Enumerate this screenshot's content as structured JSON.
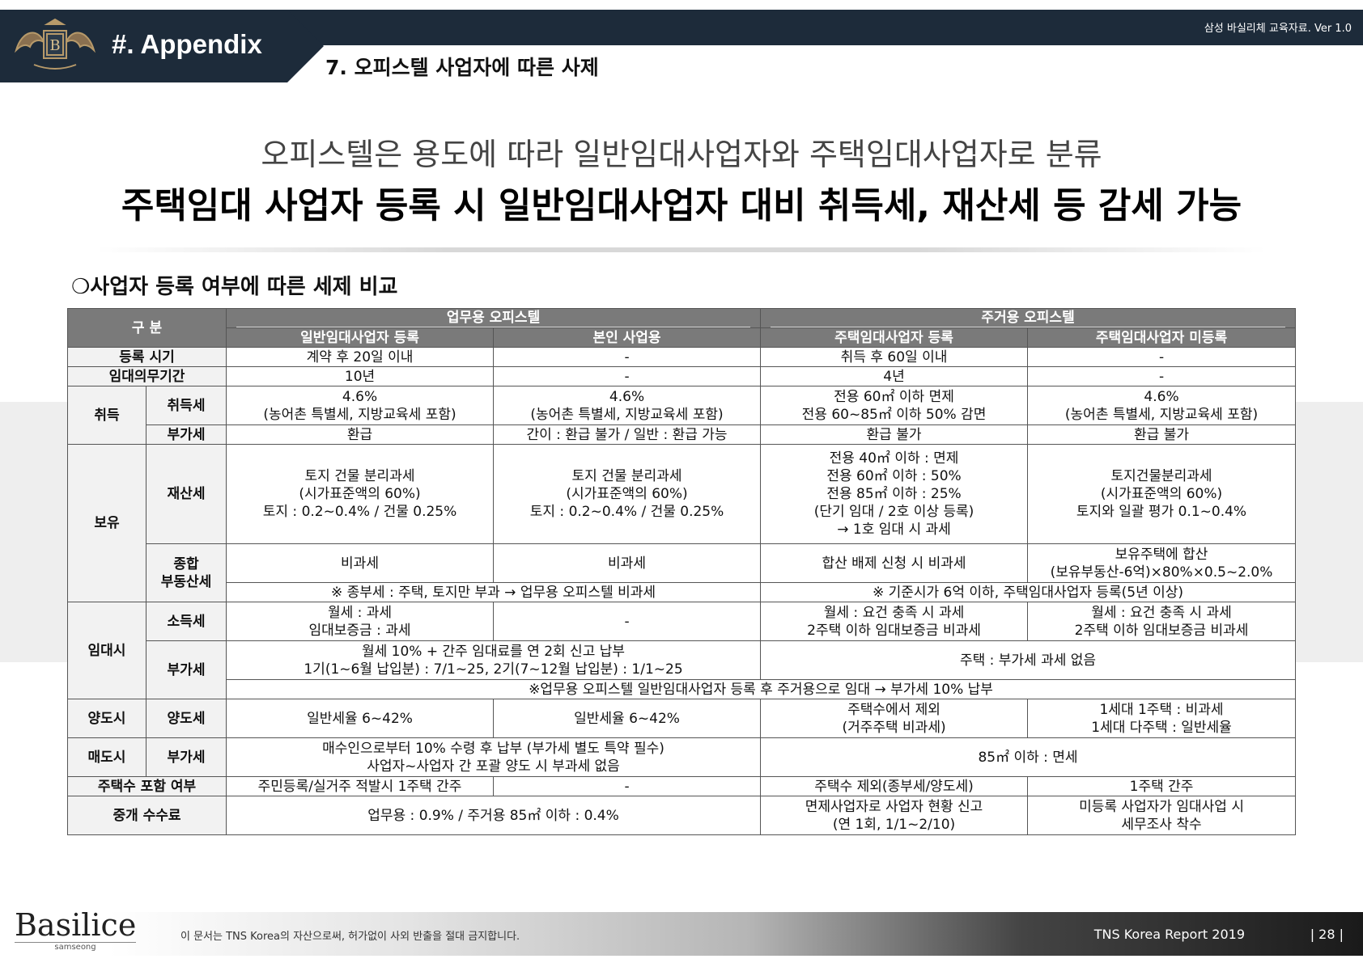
{
  "header": {
    "section": "#. Appendix",
    "title": "7. 오피스텔 사업자에 따른 사제",
    "doc_version": "삼성 바실리체 교육자료. Ver 1.0",
    "logo_icon": "crest-emblem-icon"
  },
  "headline": {
    "line1": "오피스텔은 용도에 따라 일반임대사업자와 주택임대사업자로 분류",
    "line2": "주택임대 사업자 등록 시 일반임대사업자 대비 취득세, 재산세 등 감세 가능"
  },
  "section_title": "❍사업자 등록 여부에 따른 세제 비교",
  "table": {
    "head": {
      "category": "구 분",
      "group_business": "업무용 오피스텔",
      "group_residential": "주거용 오피스텔",
      "col1": "일반임대사업자 등록",
      "col2": "본인 사업용",
      "col3": "주택임대사업자 등록",
      "col4": "주택임대사업자 미등록"
    },
    "reg_time": {
      "label": "등록 시기",
      "c1": "계약 후 20일 이내",
      "c2": "-",
      "c3": "취득 후 60일 이내",
      "c4": "-"
    },
    "lease_period": {
      "label": "임대의무기간",
      "c1": "10년",
      "c2": "-",
      "c3": "4년",
      "c4": "-"
    },
    "acquisition": {
      "group": "취득",
      "acq_tax": {
        "label": "취득세",
        "c1_l1": "4.6%",
        "c1_l2": "(농어촌 특별세, 지방교육세 포함)",
        "c2_l1": "4.6%",
        "c2_l2": "(농어촌 특별세, 지방교육세 포함)",
        "c3_l1": "전용 60㎡ 이하 면제",
        "c3_l2": "전용 60~85㎡ 이하 50% 감면",
        "c4_l1": "4.6%",
        "c4_l2": "(농어촌 특별세, 지방교육세 포함)"
      },
      "vat": {
        "label": "부가세",
        "c1": "환급",
        "c2": "간이 : 환급 불가 / 일반 : 환급 가능",
        "c3": "환급 불가",
        "c4": "환급 불가"
      }
    },
    "holding": {
      "group": "보유",
      "property_tax": {
        "label": "재산세",
        "c1_l1": "토지 건물 분리과세",
        "c1_l2": "(시가표준액의 60%)",
        "c1_l3": "토지 : 0.2~0.4% / 건물 0.25%",
        "c2_l1": "토지 건물 분리과세",
        "c2_l2": "(시가표준액의 60%)",
        "c2_l3": "토지 : 0.2~0.4% / 건물 0.25%",
        "c3_l1": "전용 40㎡ 이하 : 면제",
        "c3_l2": "전용 60㎡ 이하 : 50%",
        "c3_l3": "전용 85㎡ 이하 : 25%",
        "c3_l4": "(단기 임대 / 2호 이상 등록)",
        "c3_l5": "→ 1호 임대 시 과세",
        "c4_l1": "토지건물분리과세",
        "c4_l2": "(시가표준액의 60%)",
        "c4_l3": "토지와 일괄 평가 0.1~0.4%"
      },
      "comprehensive": {
        "label_l1": "종합",
        "label_l2": "부동산세",
        "c1": "비과세",
        "c2": "비과세",
        "c3": "합산 배제 신청 시 비과세",
        "c4_l1": "보유주택에 합산",
        "c4_l2": "(보유부동산-6억)×80%×0.5~2.0%",
        "note_business": "※ 종부세 : 주택, 토지만 부과 → 업무용 오피스텔 비과세",
        "note_residential": "※ 기준시가 6억 이하, 주택임대사업자 등록(5년 이상)"
      }
    },
    "leasing": {
      "group": "임대시",
      "income_tax": {
        "label": "소득세",
        "c1_l1": "월세 : 과세",
        "c1_l2": "임대보증금 : 과세",
        "c2": "-",
        "c3_l1": "월세 : 요건 충족 시 과세",
        "c3_l2": "2주택 이하 임대보증금 비과세",
        "c4_l1": "월세 : 요건 충족 시 과세",
        "c4_l2": "2주택 이하 임대보증금 비과세"
      },
      "vat": {
        "label": "부가세",
        "biz_l1": "월세 10% + 간주 임대료를 연 2회 신고 납부",
        "biz_l2": "1기(1~6월 납입분) : 7/1~25, 2기(7~12월 납입분) : 1/1~25",
        "res": "주택 : 부가세 과세 없음",
        "note": "※업무용 오피스텔 일반임대사업자 등록 후 주거용으로 임대 → 부가세 10% 납부"
      }
    },
    "transfer": {
      "group": "양도시",
      "label": "양도세",
      "c1": "일반세율 6~42%",
      "c2": "일반세율 6~42%",
      "c3_l1": "주택수에서 제외",
      "c3_l2": "(거주주택 비과세)",
      "c4_l1": "1세대 1주택 : 비과세",
      "c4_l2": "1세대 다주택 : 일반세율"
    },
    "sale": {
      "group": "매도시",
      "label": "부가세",
      "biz_l1": "매수인으로부터 10% 수령 후 납부 (부가세 별도 특약 필수)",
      "biz_l2": "사업자~사업자 간 포괄 양도 시 부과세 없음",
      "res": "85㎡ 이하 : 면세"
    },
    "house_count": {
      "label": "주택수 포함 여부",
      "c1": "주민등록/실거주 적발시 1주택 간주",
      "c2": "-",
      "c3": "주택수 제외(종부세/양도세)",
      "c4": "1주택 간주"
    },
    "brokerage": {
      "label": "중개 수수료",
      "biz": "업무용 : 0.9% / 주거용 85㎡ 이하 : 0.4%",
      "c3_l1": "면제사업자로 사업자 현황 신고",
      "c3_l2": "(연 1회, 1/1~2/10)",
      "c4_l1": "미등록 사업자가 임대사업 시",
      "c4_l2": "세무조사 착수"
    }
  },
  "footer": {
    "brand": "Basilice",
    "brand_sub": "samseong",
    "copyright": "이 문서는 TNS Korea의 자산으로써, 허가없이 사외 반출을 절대 금지합니다.",
    "report": "TNS Korea Report 2019",
    "page": "|  28  |"
  }
}
